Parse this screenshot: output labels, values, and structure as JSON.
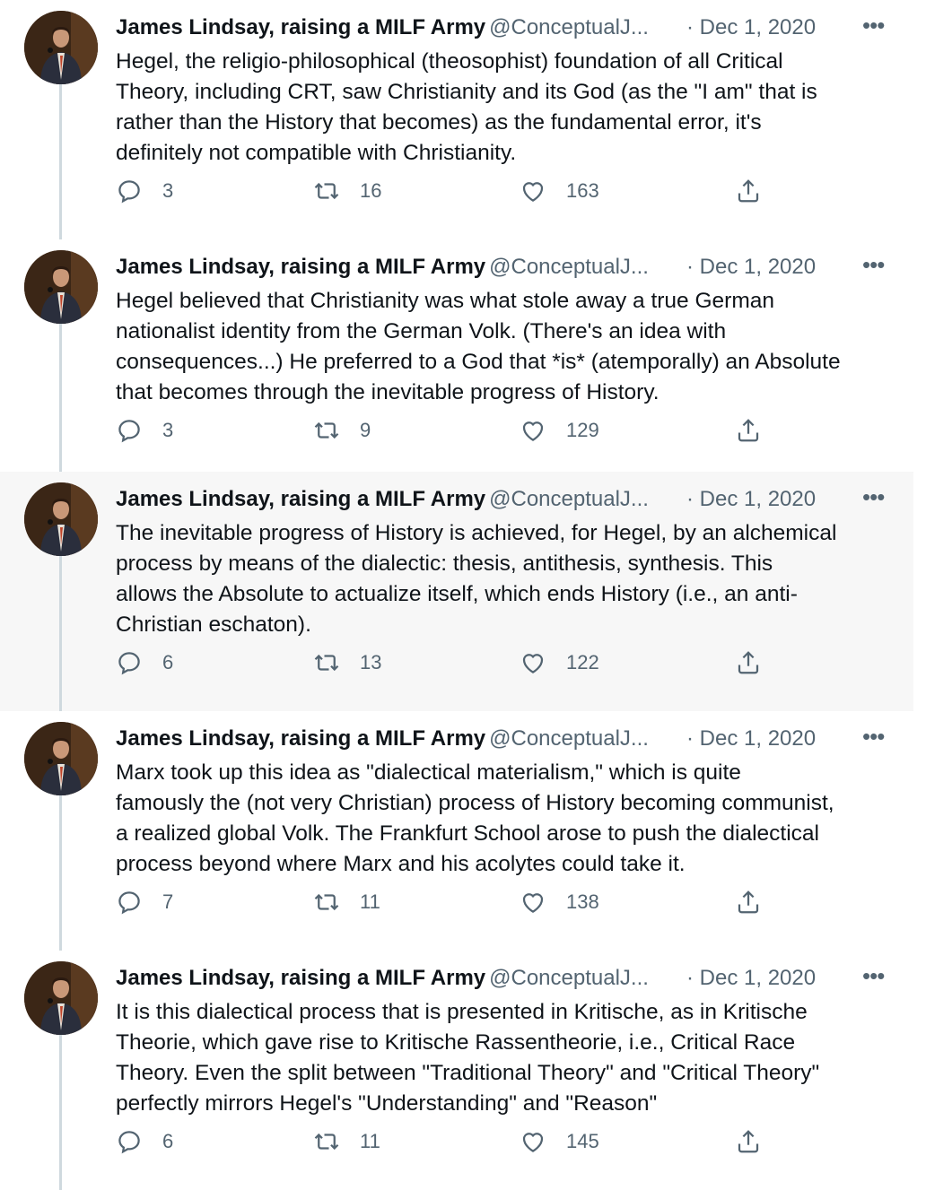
{
  "tweets": [
    {
      "author_name": "James Lindsay, raising a MILF Army",
      "handle": "@ConceptualJ...",
      "date": "· Dec 1, 2020",
      "text": "Hegel, the religio-philosophical (theosophist) foundation of all Critical\nTheory, including CRT, saw Christianity and its God (as the \"I am\" that is\nrather than the History that becomes) as the fundamental error, it's\ndefinitely not compatible with Christianity.",
      "replies": "3",
      "retweets": "16",
      "likes": "163"
    },
    {
      "author_name": "James Lindsay, raising a MILF Army",
      "handle": "@ConceptualJ...",
      "date": "· Dec 1, 2020",
      "text": "Hegel believed that Christianity was what stole away a true German\nnationalist identity from the German Volk. (There's an idea with\nconsequences...) He preferred to a God that *is* (atemporally) an Absolute\nthat becomes through the inevitable progress of History.",
      "replies": "3",
      "retweets": "9",
      "likes": "129"
    },
    {
      "author_name": "James Lindsay, raising a MILF Army",
      "handle": "@ConceptualJ...",
      "date": "· Dec 1, 2020",
      "text": "The inevitable progress of History is achieved, for Hegel, by an alchemical\nprocess by means of the dialectic: thesis, antithesis, synthesis. This\nallows the Absolute to actualize itself, which ends History (i.e., an anti-\nChristian eschaton).",
      "replies": "6",
      "retweets": "13",
      "likes": "122"
    },
    {
      "author_name": "James Lindsay, raising a MILF Army",
      "handle": "@ConceptualJ...",
      "date": "· Dec 1, 2020",
      "text": "Marx took up this idea as \"dialectical materialism,\" which is quite\nfamously the (not very Christian) process of History becoming communist,\na realized global Volk. The Frankfurt School arose to push the dialectical\nprocess beyond where Marx and his acolytes could take it.",
      "replies": "7",
      "retweets": "11",
      "likes": "138"
    },
    {
      "author_name": "James Lindsay, raising a MILF Army",
      "handle": "@ConceptualJ...",
      "date": "· Dec 1, 2020",
      "text": "It is this dialectical process that is presented in Kritische, as in Kritische\nTheorie, which gave rise to Kritische Rassentheorie, i.e., Critical Race\nTheory. Even the split between \"Traditional Theory\" and \"Critical Theory\"\nperfectly mirrors Hegel's \"Understanding\" and \"Reason\"",
      "replies": "6",
      "retweets": "11",
      "likes": "145"
    }
  ],
  "more_glyph": "•••",
  "icons": {
    "reply": "reply-icon",
    "retweet": "retweet-icon",
    "like": "like-icon",
    "share": "share-icon",
    "more": "more-icon"
  },
  "colors": {
    "text": "#0f1419",
    "secondary": "#536471",
    "thread_line": "#cfd9de",
    "highlight_bg": "#f7f7f7"
  }
}
